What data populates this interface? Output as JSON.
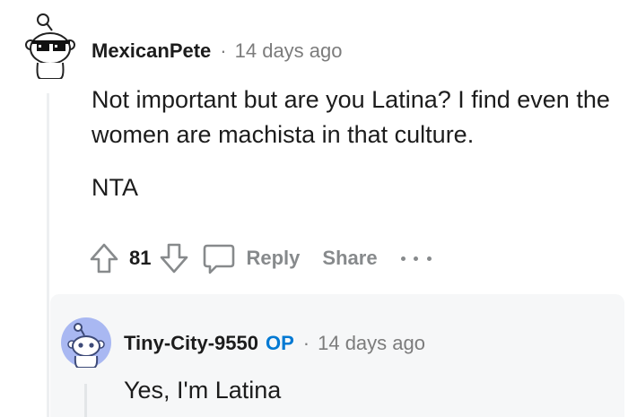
{
  "comment": {
    "username": "MexicanPete",
    "separator": "·",
    "age": "14 days ago",
    "body": [
      "Not important but are you Latina? I find even the women are machista in that culture.",
      "NTA"
    ],
    "score": "81",
    "reply_label": "Reply",
    "share_label": "Share"
  },
  "reply": {
    "username": "Tiny-City-9550",
    "op_badge": "OP",
    "separator": "·",
    "age": "14 days ago",
    "body": "Yes, I'm Latina"
  },
  "colors": {
    "meta": "#7c7c7c",
    "actions": "#878a8c",
    "op_badge": "#0079d3",
    "reply_avatar_bg": "#a9b8f2"
  },
  "icons": [
    "snoo-sunglasses-avatar",
    "upvote-icon",
    "downvote-icon",
    "comment-icon",
    "more-icon",
    "snoo-avatar"
  ]
}
